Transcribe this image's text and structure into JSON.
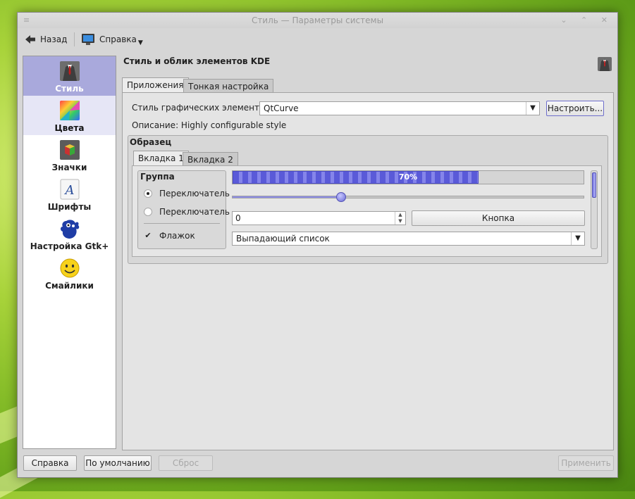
{
  "window": {
    "title": "Стиль — Параметры системы",
    "menu_glyph": "≡",
    "controls": "⌄ ⌃ ✕"
  },
  "toolbar": {
    "back_label": "Назад",
    "help_label": "Справка"
  },
  "sidebar": {
    "items": [
      {
        "label": "Стиль",
        "icon": "kde-style-suit-icon",
        "selected": true
      },
      {
        "label": "Цвета",
        "icon": "colors-icon"
      },
      {
        "label": "Значки",
        "icon": "icons-icon"
      },
      {
        "label": "Шрифты",
        "icon": "fonts-icon"
      },
      {
        "label": "Настройка Gtk+",
        "icon": "gtk-icon"
      },
      {
        "label": "Смайлики",
        "icon": "emoticons-icon"
      }
    ]
  },
  "page": {
    "title": "Стиль и облик элементов KDE",
    "tabs": [
      "Приложения",
      "Тонкая настройка"
    ],
    "widget_style_label": "Стиль графических элементов:",
    "widget_style_value": "QtCurve",
    "configure_button": "Настроить...",
    "description_label": "Описание: Highly configurable style"
  },
  "preview": {
    "title": "Образец",
    "tabs": [
      "Вкладка 1",
      "Вкладка 2"
    ],
    "group_title": "Группа",
    "radio1": "Переключатель",
    "radio2": "Переключатель",
    "checkbox": "Флажок",
    "progress_text": "70%",
    "progress_value": 0.7,
    "slider_value": 0.31,
    "spin_value": "0",
    "button": "Кнопка",
    "dropdown": "Выпадающий список"
  },
  "footer": {
    "help": "Справка",
    "defaults": "По умолчанию",
    "reset": "Сброс",
    "apply": "Применить"
  },
  "colors": {
    "accent": "#6a6ad6",
    "selection": "#a9a9dc"
  }
}
